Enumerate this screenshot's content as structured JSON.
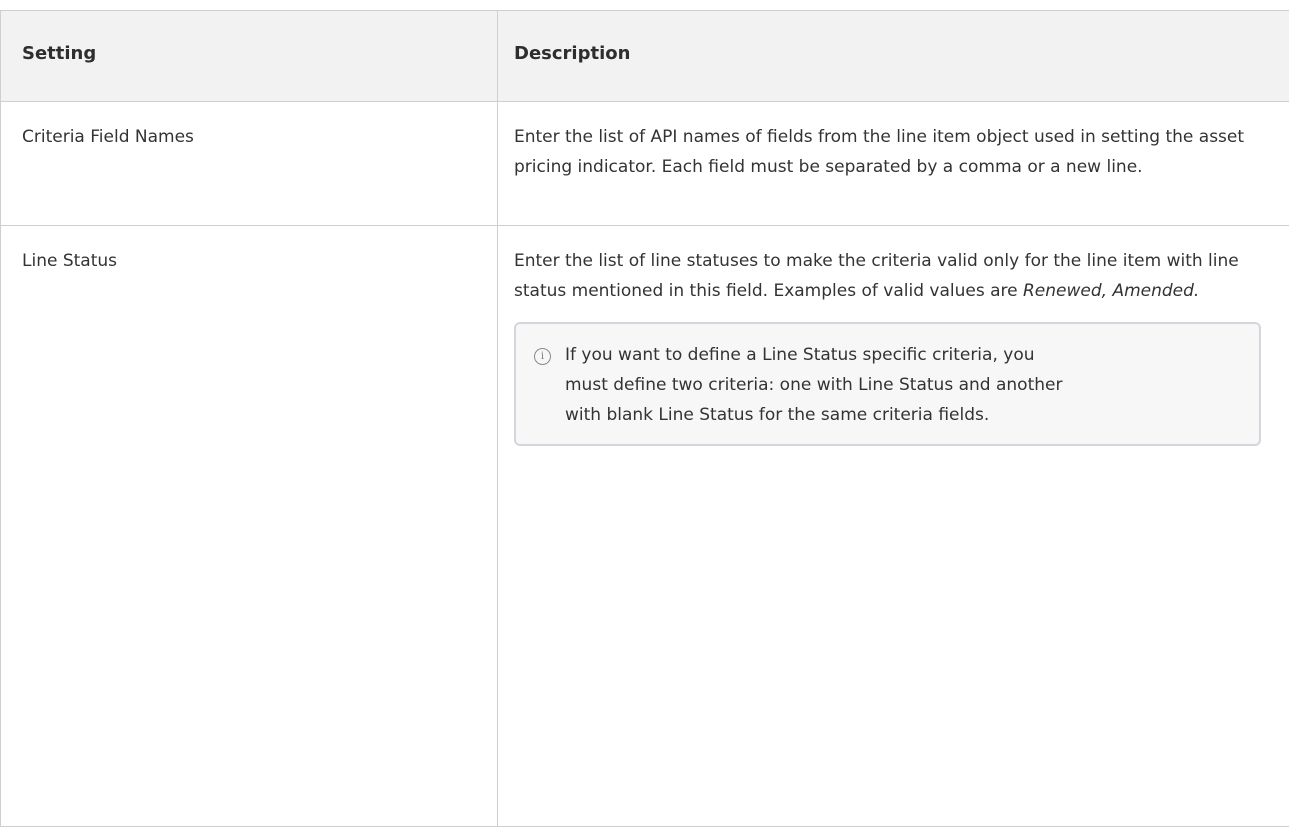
{
  "table": {
    "headers": [
      "Setting",
      "Description"
    ],
    "rows": [
      {
        "setting": "Criteria Field Names",
        "description": "Enter the list of API names of fields from the line item object used in setting the asset pricing indicator. Each field must be separated by a comma or a new line."
      },
      {
        "setting": "Line Status",
        "description_main": "Enter the list of line statuses to make the criteria valid only for the line item with line status mentioned in this field. Examples of valid values are ",
        "description_examples": "Renewed, Amended.",
        "note": {
          "icon": "info-icon",
          "text": "If you want to define a Line Status specific criteria, you must define two criteria: one with Line Status and another with blank Line Status for the same criteria fields."
        }
      }
    ]
  }
}
